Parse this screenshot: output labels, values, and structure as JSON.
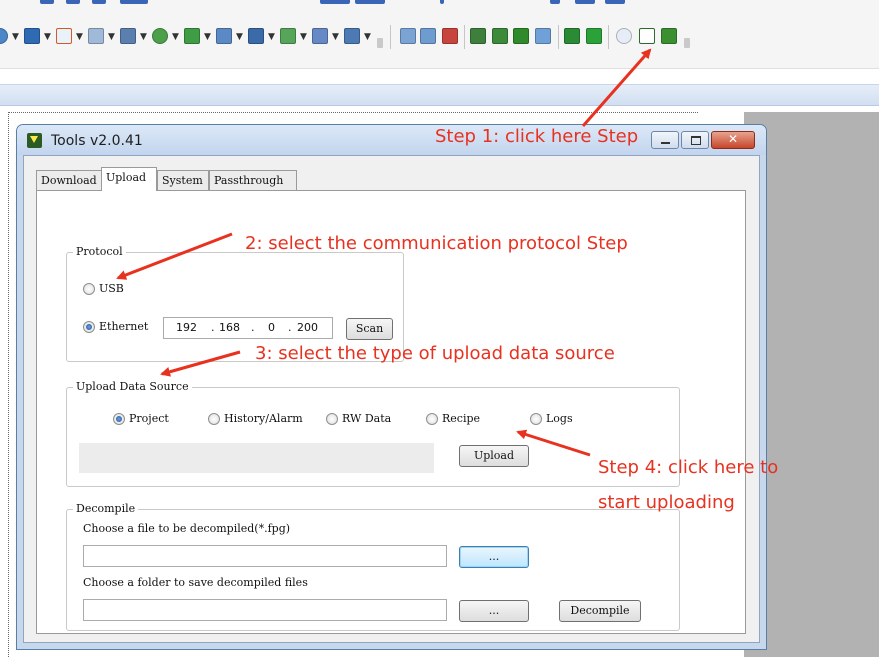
{
  "window": {
    "title": "Tools v2.0.41",
    "close_glyph": "✕"
  },
  "tabs": [
    {
      "label": "Download",
      "active": false
    },
    {
      "label": "Upload",
      "active": true
    },
    {
      "label": "System",
      "active": false
    },
    {
      "label": "Passthrough",
      "active": false
    }
  ],
  "protocol": {
    "legend": "Protocol",
    "usb_label": "USB",
    "ethernet_label": "Ethernet",
    "selected": "Ethernet",
    "ip": [
      "192",
      "168",
      "0",
      "200"
    ],
    "scan_label": "Scan"
  },
  "upload_source": {
    "legend": "Upload Data Source",
    "options": [
      {
        "label": "Project",
        "selected": true
      },
      {
        "label": "History/Alarm",
        "selected": false
      },
      {
        "label": "RW Data",
        "selected": false
      },
      {
        "label": "Recipe",
        "selected": false
      },
      {
        "label": "Logs",
        "selected": false
      }
    ],
    "upload_label": "Upload"
  },
  "decompile": {
    "legend": "Decompile",
    "file_prompt": "Choose a file to be decompiled(*.fpg)",
    "folder_prompt": "Choose a folder to save decompiled files",
    "browse_label": "...",
    "decompile_label": "Decompile"
  },
  "annotations": {
    "step1": "Step 1: click here Step",
    "step2": "2: select the communication protocol Step",
    "step3": "3: select the type of upload data source",
    "step4_line1": "Step 4: click here to",
    "step4_line2": "start uploading"
  },
  "colors": {
    "annotation": "#e8311f",
    "titlebar": "#c7d7ec",
    "radio_selected": "#1d4f9b"
  },
  "toolbar_icons": [
    "chart-icon",
    "table-icon",
    "trend-icon",
    "meter-icon",
    "grid-icon",
    "valve-icon",
    "move-icon",
    "display-icon",
    "report-icon",
    "color-icon",
    "line-icon",
    "tree-icon",
    "compile-icon",
    "compile-all-icon",
    "clear-compile-icon",
    "download-icon",
    "download-all-icon",
    "upload-icon",
    "tools-icon",
    "offline-sim-icon",
    "online-sim-icon",
    "network-icon",
    "csv-icon",
    "ram-icon"
  ]
}
